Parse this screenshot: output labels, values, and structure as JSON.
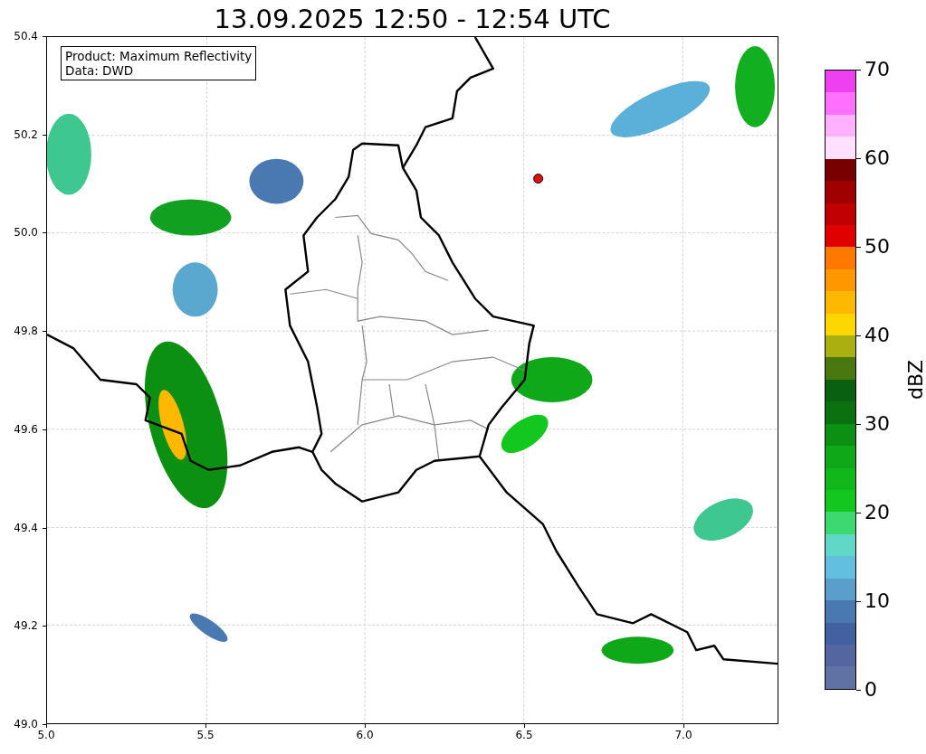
{
  "title": "13.09.2025 12:50 - 12:54 UTC",
  "map": {
    "info_box": [
      "Product: Maximum Reflectivity",
      "Data: DWD"
    ],
    "x_ticks": [
      "5.0",
      "5.5",
      "6.0",
      "6.5",
      "7.0"
    ],
    "y_ticks": [
      "50.4",
      "50.2",
      "50.0",
      "49.8",
      "49.6",
      "49.4",
      "49.2",
      "49.0"
    ]
  },
  "colorbar": {
    "label": "dBZ",
    "ticks": [
      "70",
      "60",
      "50",
      "40",
      "30",
      "20",
      "10",
      "0"
    ],
    "bins": [
      {
        "color": "#ee40ee"
      },
      {
        "color": "#ff70ff"
      },
      {
        "color": "#ffb0ff"
      },
      {
        "color": "#ffe0ff"
      },
      {
        "color": "#780000"
      },
      {
        "color": "#a00000"
      },
      {
        "color": "#c00000"
      },
      {
        "color": "#e00000"
      },
      {
        "color": "#ff7800"
      },
      {
        "color": "#ff9800"
      },
      {
        "color": "#ffb800"
      },
      {
        "color": "#ffd700"
      },
      {
        "color": "#aab010"
      },
      {
        "color": "#4a7810"
      },
      {
        "color": "#086010"
      },
      {
        "color": "#0a7010"
      },
      {
        "color": "#0c9012"
      },
      {
        "color": "#0fa818"
      },
      {
        "color": "#10b81a"
      },
      {
        "color": "#12c81e"
      },
      {
        "color": "#3ed870"
      },
      {
        "color": "#60d8c8"
      },
      {
        "color": "#62bfe0"
      },
      {
        "color": "#5a9ecc"
      },
      {
        "color": "#4a78b0"
      },
      {
        "color": "#4360a0"
      },
      {
        "color": "#5466a0"
      },
      {
        "color": "#6072a4"
      }
    ]
  }
}
